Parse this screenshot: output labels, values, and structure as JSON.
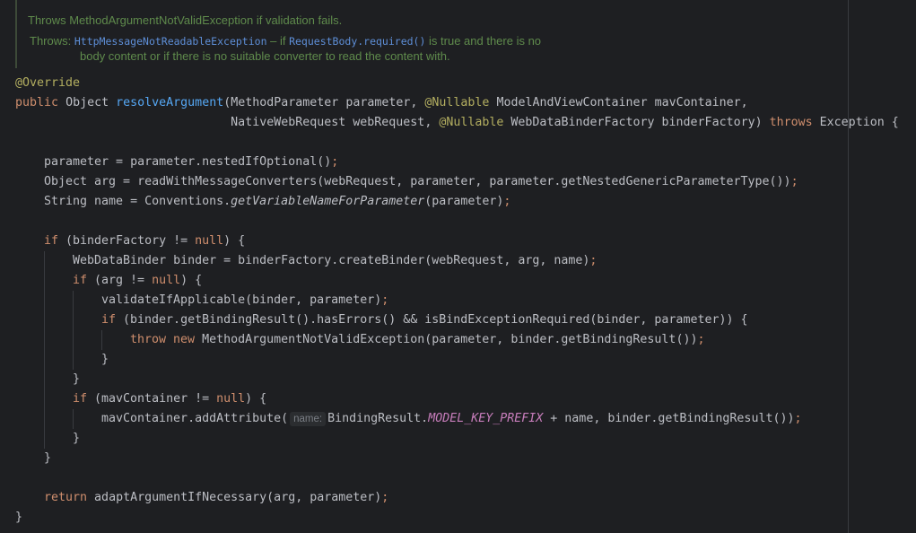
{
  "doc": {
    "line1": "Throws MethodArgumentNotValidException if validation fails.",
    "throws_label": "Throws:",
    "throws_ex": "HttpMessageNotReadableException",
    "throws_mid": " – if ",
    "throws_ref": "RequestBody.required()",
    "throws_tail": " is true and there is no",
    "line3": "body content or if there is no suitable converter to read the content with."
  },
  "code": {
    "override": "@Override",
    "public": "public",
    "sp": " ",
    "obj_type": "Object",
    "method": "resolveArgument",
    "open_paren": "(",
    "p1_type": "MethodParameter parameter, ",
    "nullable": "@Nullable",
    "p2": " ModelAndViewContainer mavContainer,",
    "sig2_indent": "                              ",
    "p3": "NativeWebRequest webRequest, ",
    "p4": " WebDataBinderFactory binderFactory) ",
    "throws": "throws",
    "sig_end": " Exception {",
    "l1": "parameter = parameter.nestedIfOptional()",
    "semi": ";",
    "l2": "Object arg = readWithMessageConverters(webRequest, parameter, parameter.getNestedGenericParameterType())",
    "l3a": "String name = Conventions.",
    "l3b": "getVariableNameForParameter",
    "l3c": "(parameter)",
    "if": "if",
    "cond1": " (binderFactory != ",
    "null": "null",
    "brace_open": ") {",
    "l4": "WebDataBinder binder = binderFactory.createBinder(webRequest, arg, name)",
    "cond2": " (arg != ",
    "l5": "validateIfApplicable(binder, parameter)",
    "cond3": " (binder.getBindingResult().hasErrors() && isBindExceptionRequired(binder, parameter)) {",
    "throw_kw": "throw",
    "new_kw": "new",
    "l6": " MethodArgumentNotValidException(parameter, binder.getBindingResult())",
    "close_brace": "}",
    "cond4": " (mavContainer != ",
    "l7a": "mavContainer.addAttribute(",
    "hint_name": "name:",
    "l7b": "BindingResult.",
    "model_key": "MODEL_KEY_PREFIX",
    "l7c": " + name, binder.getBindingResult())",
    "return_kw": "return",
    "l8": " adaptArgumentIfNecessary(arg, parameter)"
  }
}
